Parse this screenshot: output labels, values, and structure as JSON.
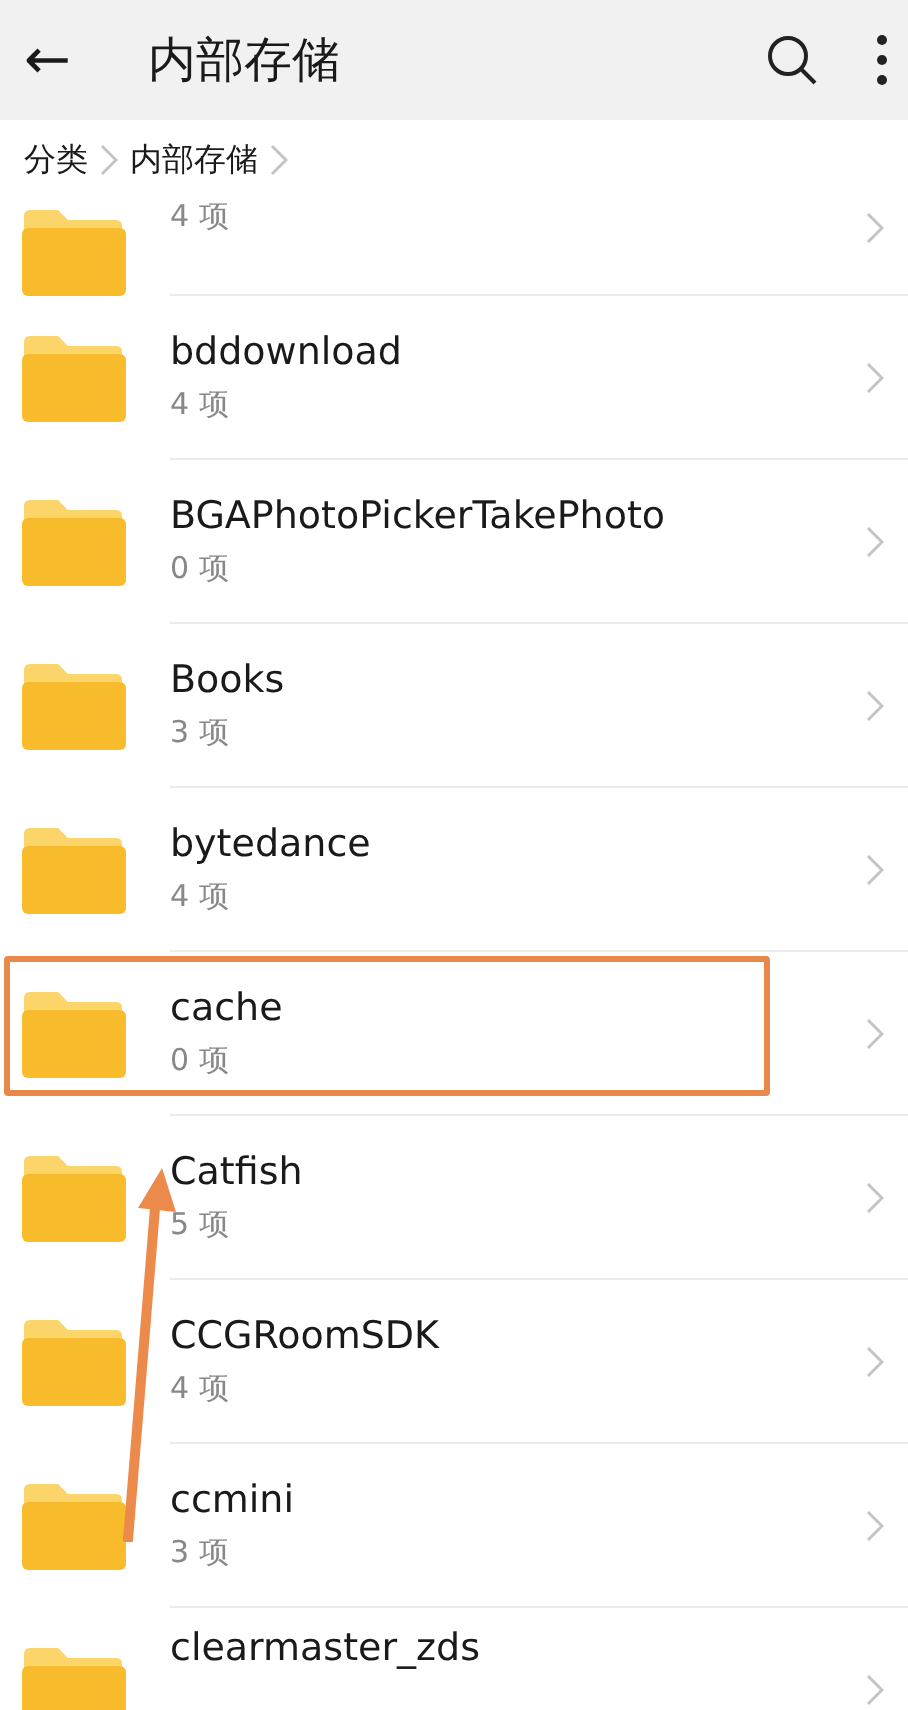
{
  "header": {
    "back": "←",
    "title": "内部存储"
  },
  "breadcrumb": [
    {
      "label": "分类"
    },
    {
      "label": "内部存储"
    }
  ],
  "folders": [
    {
      "count": "4 项",
      "highlighted": false,
      "pointed": false
    },
    {
      "name": "bddownload",
      "count": "4 项",
      "highlighted": false,
      "pointed": false
    },
    {
      "name": "BGAPhotoPickerTakePhoto",
      "count": "0 项",
      "highlighted": false,
      "pointed": false
    },
    {
      "name": "Books",
      "count": "3 项",
      "highlighted": false,
      "pointed": false
    },
    {
      "name": "bytedance",
      "count": "4 项",
      "highlighted": false,
      "pointed": false
    },
    {
      "name": "cache",
      "count": "0 项",
      "highlighted": true,
      "pointed": false
    },
    {
      "name": "Catfish",
      "count": "5 项",
      "highlighted": false,
      "pointed": true
    },
    {
      "name": "CCGRoomSDK",
      "count": "4 项",
      "highlighted": false,
      "pointed": false
    },
    {
      "name": "ccmini",
      "count": "3 项",
      "highlighted": false,
      "pointed": false
    },
    {
      "name": "clearmaster_zds",
      "highlighted": false,
      "pointed": false
    }
  ]
}
